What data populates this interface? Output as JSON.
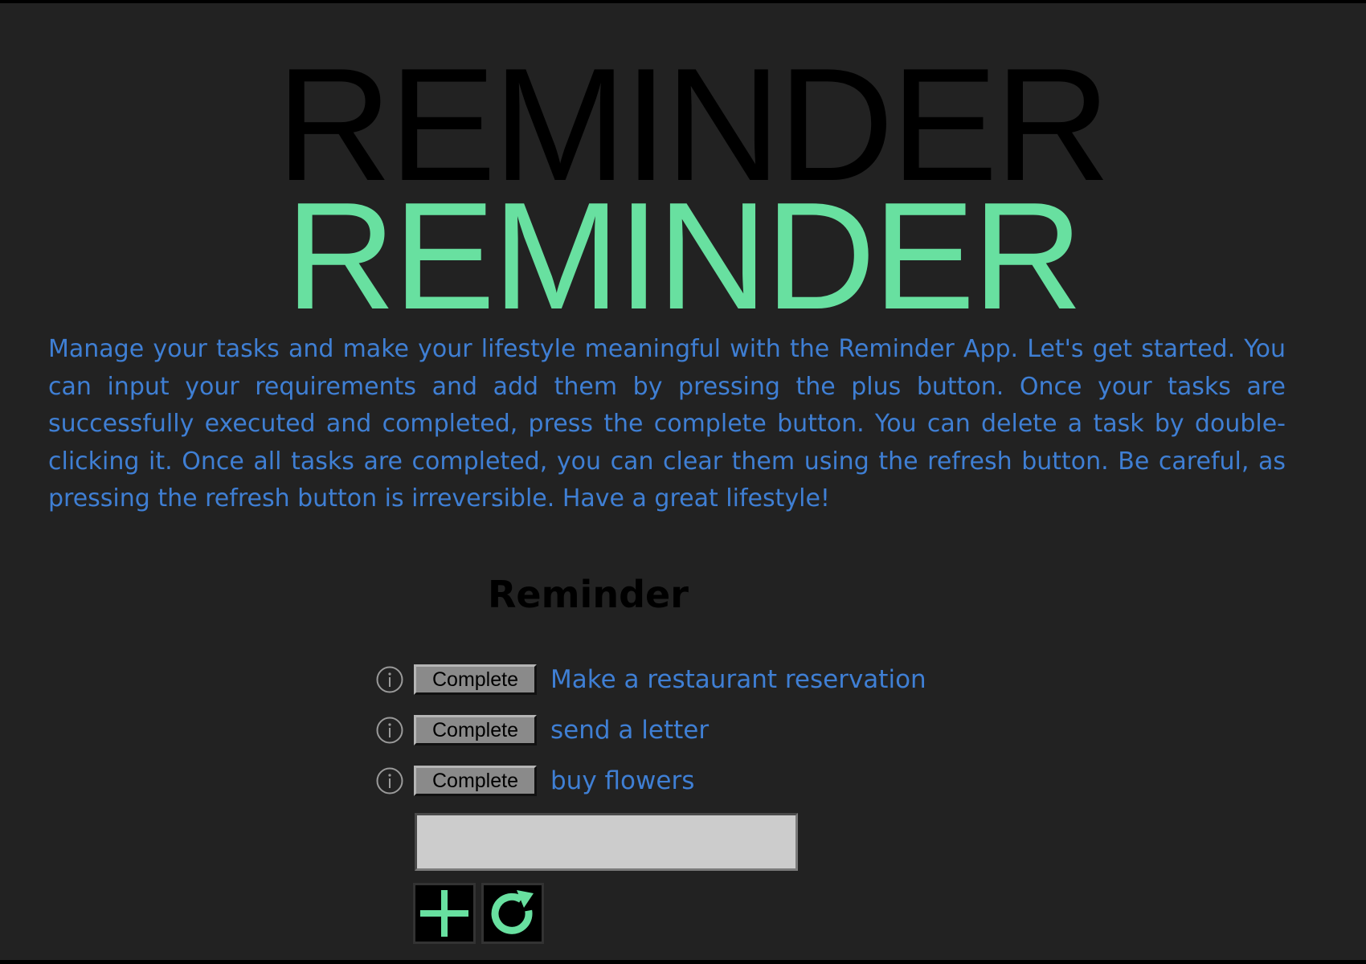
{
  "title": {
    "shadow_text": "REMINDER",
    "main_text": "REMINDER"
  },
  "intro_text": "Manage your tasks and make your lifestyle meaningful with the Reminder App. Let's get started. You can input your requirements and add them by pressing the plus button. Once your tasks are successfully executed and completed, press the complete button. You can delete a task by double-clicking it. Once all tasks are completed, you can clear them using the refresh button. Be careful, as pressing the refresh button is irreversible. Have a great lifestyle!",
  "list": {
    "heading": "Reminder",
    "items": [
      {
        "complete_label": "Complete",
        "text": "Make a restaurant reservation",
        "icon": "info-icon"
      },
      {
        "complete_label": "Complete",
        "text": "send a letter",
        "icon": "info-icon"
      },
      {
        "complete_label": "Complete",
        "text": "buy flowers",
        "icon": "info-icon"
      }
    ]
  },
  "input": {
    "value": "",
    "placeholder": ""
  },
  "buttons": {
    "add_icon": "plus-icon",
    "refresh_icon": "refresh-icon"
  },
  "colors": {
    "background": "#222222",
    "accent_green": "#68e0a0",
    "text_blue": "#3f7fd4",
    "button_gray": "#8a8a8a",
    "input_gray": "#cccccc"
  }
}
